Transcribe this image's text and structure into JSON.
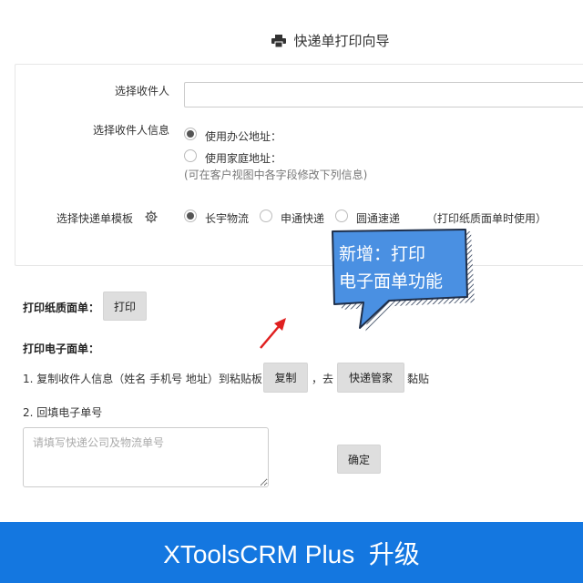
{
  "header": {
    "title": "快递单打印向导",
    "icon": "printer-icon"
  },
  "form": {
    "recipient_label": "选择收件人",
    "recipient_value": "",
    "info_label": "选择收件人信息",
    "address_options": [
      "使用办公地址：",
      "使用家庭地址："
    ],
    "address_selected": 0,
    "address_hint": "(可在客户视图中各字段修改下列信息)",
    "template_label": "选择快递单模板",
    "templates": [
      "长宇物流",
      "申通快递",
      "圆通速递"
    ],
    "template_selected": 0,
    "template_hint": "（打印纸质面单时使用）"
  },
  "print_paper": {
    "label": "打印纸质面单：",
    "button": "打印"
  },
  "print_electronic": {
    "label": "打印电子面单：",
    "step1_text": "1. 复制收件人信息（姓名 手机号 地址）到粘贴板",
    "copy_button": "复制",
    "go_text": "，去",
    "manager_button": "快递管家",
    "paste_text": "黏贴",
    "step2_text": "2. 回填电子单号",
    "tracking_value": "",
    "tracking_placeholder": "请填写快递公司及物流单号",
    "confirm_button": "确定"
  },
  "callout": {
    "line1": "新增：打印",
    "line2": "电子面单功能"
  },
  "banner": {
    "text": "XToolsCRM Plus  升级"
  },
  "colors": {
    "banner": "#1477e0",
    "callout_fill": "#4a90e2",
    "arrow": "#e02020"
  }
}
